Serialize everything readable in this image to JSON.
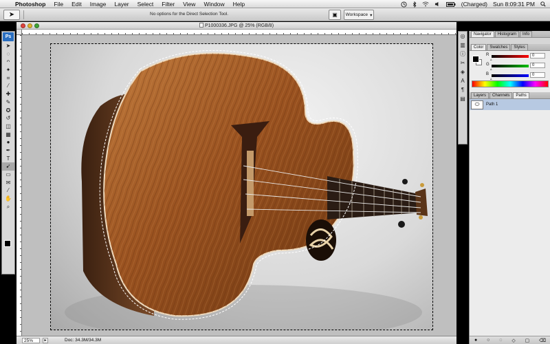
{
  "menubar": {
    "items": [
      "Photoshop",
      "File",
      "Edit",
      "Image",
      "Layer",
      "Select",
      "Filter",
      "View",
      "Window",
      "Help"
    ],
    "battery": "(Charged)",
    "clock": "Sun 8:09:31 PM"
  },
  "options_bar": {
    "tool_hint": "No options for the Direct Selection Tool.",
    "workspace_label": "Workspace"
  },
  "tools": {
    "ps_logo": "Ps",
    "icons": [
      "arrow-icon",
      "marquee-icon",
      "lasso-icon",
      "quick-select-icon",
      "crop-icon",
      "eyedropper-icon",
      "healing-icon",
      "brush-icon",
      "clone-stamp-icon",
      "history-brush-icon",
      "eraser-icon",
      "gradient-icon",
      "dodge-icon",
      "pen-icon",
      "type-icon",
      "path-select-icon",
      "shape-icon",
      "notes-icon",
      "eyedropper2-icon",
      "hand-icon",
      "zoom-icon"
    ],
    "glyphs": [
      "➤",
      "◌",
      "ᴖ",
      "✦",
      "⌗",
      "⁄",
      "✚",
      "✎",
      "✪",
      "↺",
      "◫",
      "▦",
      "●",
      "✒",
      "T",
      "➹",
      "▭",
      "✉",
      "⁄",
      "✋",
      "⌕"
    ],
    "active_index": 15
  },
  "document": {
    "title": "P1000336.JPG @ 25% (RGB/8)",
    "zoom": "25%",
    "doc_size": "Doc: 34.3M/34.3M"
  },
  "panels": {
    "group1_tabs": [
      "Navigator",
      "Histogram",
      "Info"
    ],
    "group2_tabs": [
      "Color",
      "Swatches",
      "Styles"
    ],
    "color": {
      "channels": [
        {
          "label": "R",
          "value": "0",
          "gradient": "#ff0000"
        },
        {
          "label": "G",
          "value": "0",
          "gradient": "#00c000"
        },
        {
          "label": "B",
          "value": "0",
          "gradient": "#0000ff"
        }
      ]
    },
    "group3_tabs": [
      "Layers",
      "Channels",
      "Paths"
    ],
    "paths": [
      {
        "name": "Path 1"
      }
    ]
  },
  "dock_icons": [
    "navigator-icon",
    "histogram-icon",
    "info-icon",
    "tools-icon",
    "swatch-icon",
    "character-icon",
    "paragraph-icon",
    "layer-comps-icon"
  ],
  "dock_glyphs": [
    "◎",
    "▥",
    "ⓘ",
    "✂",
    "◈",
    "A",
    "¶",
    "▤"
  ]
}
